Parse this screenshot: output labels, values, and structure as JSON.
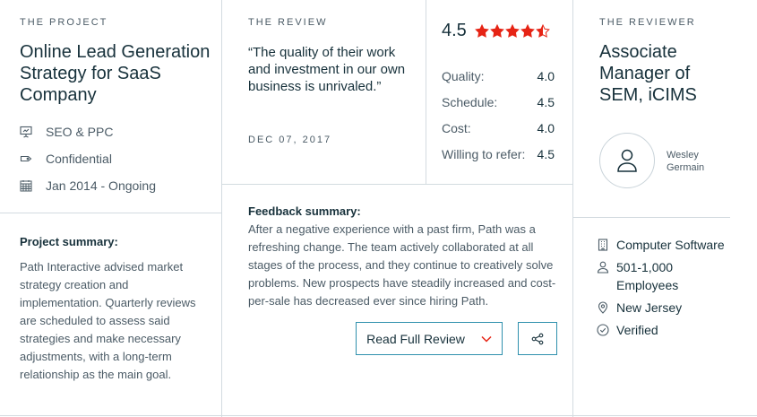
{
  "project": {
    "eyebrow": "THE PROJECT",
    "title": "Online Lead Generation Strategy for SaaS Company",
    "meta": [
      {
        "icon": "presentation-icon",
        "text": "SEO & PPC"
      },
      {
        "icon": "tag-icon",
        "text": "Confidential"
      },
      {
        "icon": "calendar-icon",
        "text": "Jan 2014 - Ongoing"
      }
    ],
    "summary_label": "Project summary:",
    "summary_text": "Path Interactive advised market strategy creation and implementation. Quarterly reviews are scheduled to assess said strategies and make necessary adjustments, with a long-term relationship as the main goal."
  },
  "review": {
    "eyebrow": "THE REVIEW",
    "quote": "“The quality of their work and investment in our own business is unrivaled.”",
    "date": "DEC 07, 2017",
    "overall_rating": "4.5",
    "stars": 4.5,
    "star_color": "#e62415",
    "scores": [
      {
        "label": "Quality:",
        "value": "4.0"
      },
      {
        "label": "Schedule:",
        "value": "4.5"
      },
      {
        "label": "Cost:",
        "value": "4.0"
      },
      {
        "label": "Willing to refer:",
        "value": "4.5"
      }
    ],
    "feedback_label": "Feedback summary:",
    "feedback_text": "After a negative experience with a past firm, Path was a refreshing change. The team actively collaborated at all stages of the process, and they continue to creatively solve problems. New prospects have steadily increased and cost-per-sale has decreased ever since hiring Path.",
    "read_more_label": "Read Full Review",
    "read_more_icon": "chevron-down-icon",
    "share_icon": "share-icon",
    "accent_color": "#2f90ad"
  },
  "reviewer": {
    "eyebrow": "THE REVIEWER",
    "title": "Associate Manager of SEM, iCIMS",
    "name": "Wesley Germain",
    "details": [
      {
        "icon": "building-icon",
        "text": "Computer Software"
      },
      {
        "icon": "person-icon",
        "text": "501-1,000 Employees"
      },
      {
        "icon": "location-pin-icon",
        "text": "New Jersey"
      },
      {
        "icon": "check-circle-icon",
        "text": "Verified"
      }
    ]
  }
}
